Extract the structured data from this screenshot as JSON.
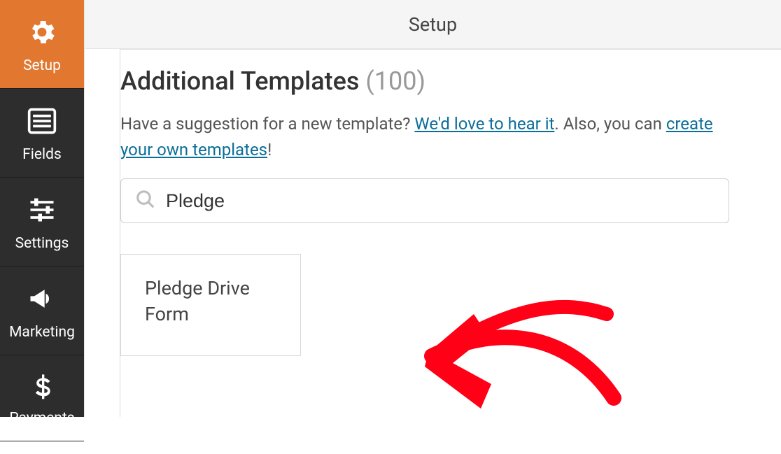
{
  "sidebar": {
    "items": [
      {
        "label": "Setup"
      },
      {
        "label": "Fields"
      },
      {
        "label": "Settings"
      },
      {
        "label": "Marketing"
      },
      {
        "label": "Payments"
      }
    ]
  },
  "header": {
    "title": "Setup"
  },
  "main": {
    "heading": "Additional Templates ",
    "heading_count": "(100)",
    "lead_part1": "Have a suggestion for a new template? ",
    "lead_link1": "We'd love to hear it",
    "lead_part2": ". Also, you can ",
    "lead_link2": "create your own templates",
    "lead_part3": "!"
  },
  "search": {
    "value": "Pledge",
    "placeholder": "Search"
  },
  "templates": [
    {
      "name": "Pledge Drive Form"
    }
  ]
}
